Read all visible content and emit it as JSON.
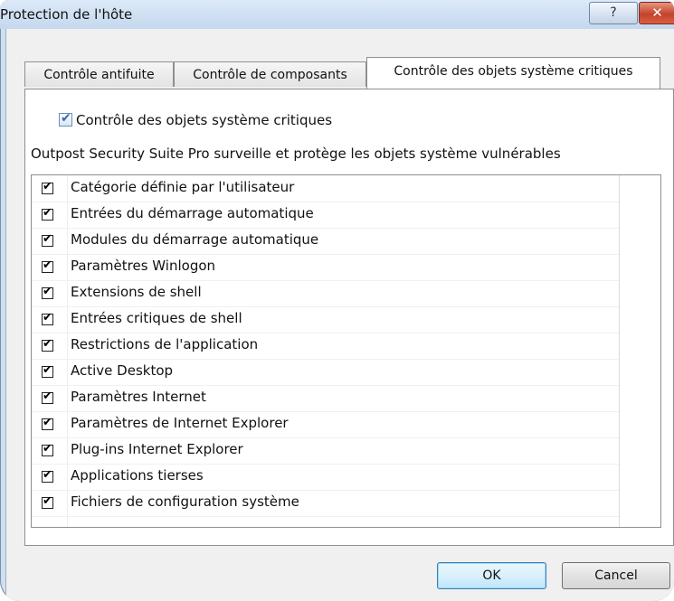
{
  "window": {
    "title": "Protection de l'hôte",
    "help_symbol": "?",
    "close_symbol": "✕"
  },
  "tabs": [
    {
      "label": "Contrôle antifuite",
      "active": false
    },
    {
      "label": "Contrôle de composants",
      "active": false
    },
    {
      "label": "Contrôle des objets système critiques",
      "active": true
    }
  ],
  "panel": {
    "enable_checkbox": {
      "label": "Contrôle des objets système critiques",
      "checked": true
    },
    "description": "Outpost Security Suite Pro surveille et protège les objets système vulnérables",
    "items": [
      {
        "label": "Catégorie définie par l'utilisateur",
        "checked": true
      },
      {
        "label": "Entrées du démarrage automatique",
        "checked": true
      },
      {
        "label": "Modules du démarrage automatique",
        "checked": true
      },
      {
        "label": "Paramètres Winlogon",
        "checked": true
      },
      {
        "label": "Extensions de shell",
        "checked": true
      },
      {
        "label": "Entrées critiques de shell",
        "checked": true
      },
      {
        "label": "Restrictions de l'application",
        "checked": true
      },
      {
        "label": "Active Desktop",
        "checked": true
      },
      {
        "label": "Paramètres Internet",
        "checked": true
      },
      {
        "label": "Paramètres de Internet Explorer",
        "checked": true
      },
      {
        "label": "Plug-ins Internet Explorer",
        "checked": true
      },
      {
        "label": "Applications tierses",
        "checked": true
      },
      {
        "label": "Fichiers de configuration système",
        "checked": true
      }
    ]
  },
  "buttons": {
    "ok": "OK",
    "cancel": "Cancel"
  },
  "check_glyph": "✔",
  "colors": {
    "accent": "#3c7fb1",
    "close": "#c4432b"
  }
}
